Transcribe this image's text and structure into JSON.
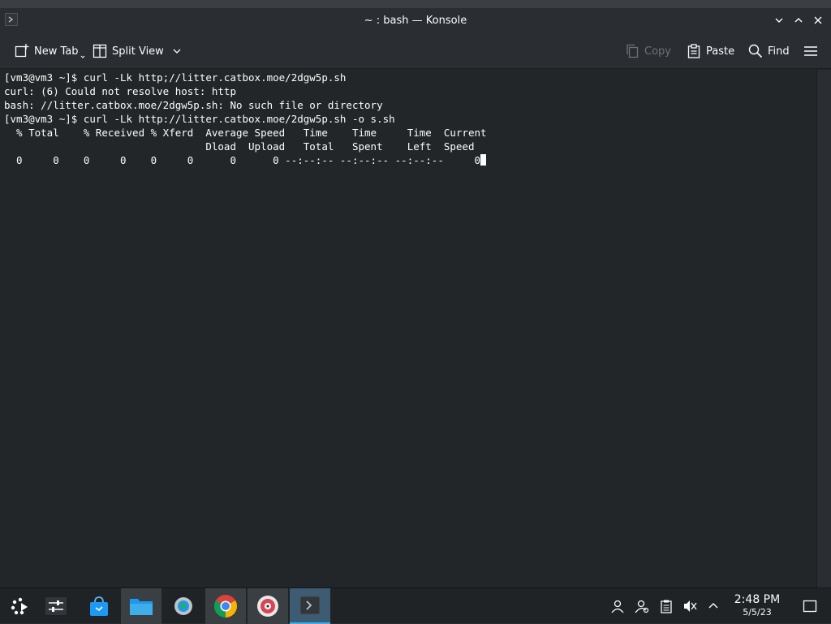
{
  "window": {
    "title": "~ : bash — Konsole"
  },
  "toolbar": {
    "new_tab": "New Tab",
    "split_view": "Split View",
    "copy": "Copy",
    "paste": "Paste",
    "find": "Find"
  },
  "terminal": {
    "lines": [
      "[vm3@vm3 ~]$ curl -Lk http;//litter.catbox.moe/2dgw5p.sh",
      "curl: (6) Could not resolve host: http",
      "bash: //litter.catbox.moe/2dgw5p.sh: No such file or directory",
      "[vm3@vm3 ~]$ curl -Lk http://litter.catbox.moe/2dgw5p.sh -o s.sh",
      "  % Total    % Received % Xferd  Average Speed   Time    Time     Time  Current",
      "                                 Dload  Upload   Total   Spent    Left  Speed",
      "  0     0    0     0    0     0      0      0 --:--:-- --:--:-- --:--:--     0"
    ]
  },
  "taskbar": {
    "apps": [
      "app-launcher",
      "system-settings-panel",
      "discover-store",
      "dolphin-files",
      "steam-settings",
      "google-chrome",
      "media-disc",
      "konsole"
    ],
    "time": "2:48 PM",
    "date": "5/5/23"
  },
  "colors": {
    "terminal_bg": "#232629",
    "chrome_bg": "#2a2e32",
    "accent": "#3daee9",
    "text": "#fcfcfc"
  }
}
